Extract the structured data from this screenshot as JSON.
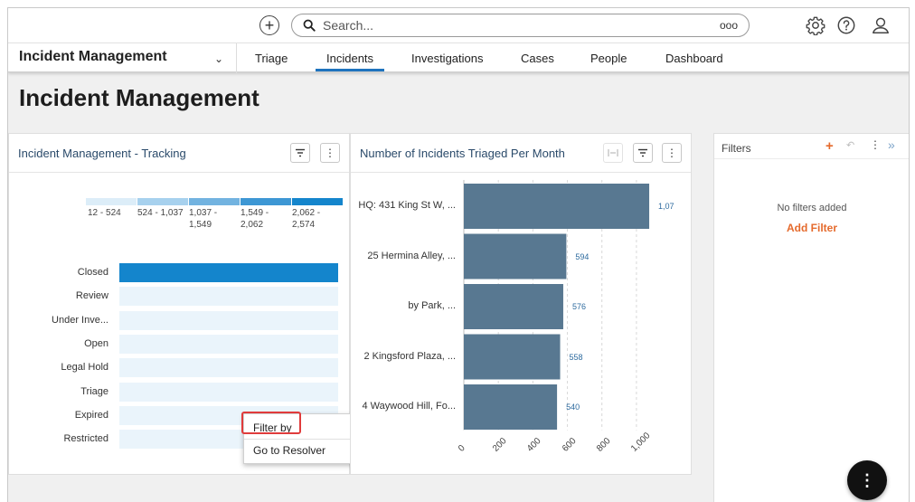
{
  "topbar": {
    "search_placeholder": "Search...",
    "search_more": "ooo",
    "icons": [
      "add-icon",
      "search-icon",
      "gear-icon",
      "help-icon",
      "user-icon"
    ]
  },
  "nav": {
    "app_name": "Incident Management",
    "tabs": [
      {
        "label": "Triage"
      },
      {
        "label": "Incidents"
      },
      {
        "label": "Investigations"
      },
      {
        "label": "Cases"
      },
      {
        "label": "People"
      },
      {
        "label": "Dashboard"
      }
    ],
    "active_tab": "Incidents",
    "active_color": "#1e73be"
  },
  "page": {
    "title": "Incident Management"
  },
  "tracking": {
    "title": "Incident Management - Tracking",
    "legend": [
      {
        "line1": "12 - 524",
        "line2": "",
        "color": "#dcedf8"
      },
      {
        "line1": "524 - 1,037",
        "line2": "",
        "color": "#a7d1ee"
      },
      {
        "line1": "1,037 -",
        "line2": "1,549",
        "color": "#72b3e0"
      },
      {
        "line1": "1,549 -",
        "line2": "2,062",
        "color": "#3d97d4"
      },
      {
        "line1": "2,062 -",
        "line2": "2,574",
        "color": "#1485cc"
      }
    ],
    "rows": [
      {
        "label": "Closed"
      },
      {
        "label": "Review"
      },
      {
        "label": "Under Inve..."
      },
      {
        "label": "Open"
      },
      {
        "label": "Legal Hold"
      },
      {
        "label": "Triage"
      },
      {
        "label": "Expired"
      },
      {
        "label": "Restricted"
      }
    ],
    "context_menu": {
      "items": [
        {
          "label": "Filter by"
        },
        {
          "label": "Go to Resolver"
        }
      ],
      "highlight_color": "#e03b3b"
    }
  },
  "triaged_chart": {
    "panel_title": "Number of Incidents Triaged Per Month",
    "bar_color": "#587891",
    "chart_data": {
      "type": "bar",
      "orientation": "horizontal",
      "title": "Number of Incidents Triaged Per Month",
      "categories": [
        "HQ: 431 King St W, ...",
        "25 Hermina Alley, ...",
        "by Park, ...",
        "2 Kingsford Plaza, ...",
        "4 Waywood Hill, Fo..."
      ],
      "value_labels": [
        "1,07",
        "594",
        "576",
        "558",
        "540"
      ],
      "values": [
        1074,
        594,
        576,
        558,
        540
      ],
      "xlim": [
        0,
        1100
      ],
      "xticks": [
        "0",
        "200",
        "400",
        "600",
        "800",
        "1,000"
      ],
      "grid": true
    }
  },
  "filters": {
    "title": "Filters",
    "empty_text": "No filters added",
    "add_label": "Add Filter",
    "accent_color": "#e56a2c"
  },
  "fab": {
    "label": "⋮"
  }
}
